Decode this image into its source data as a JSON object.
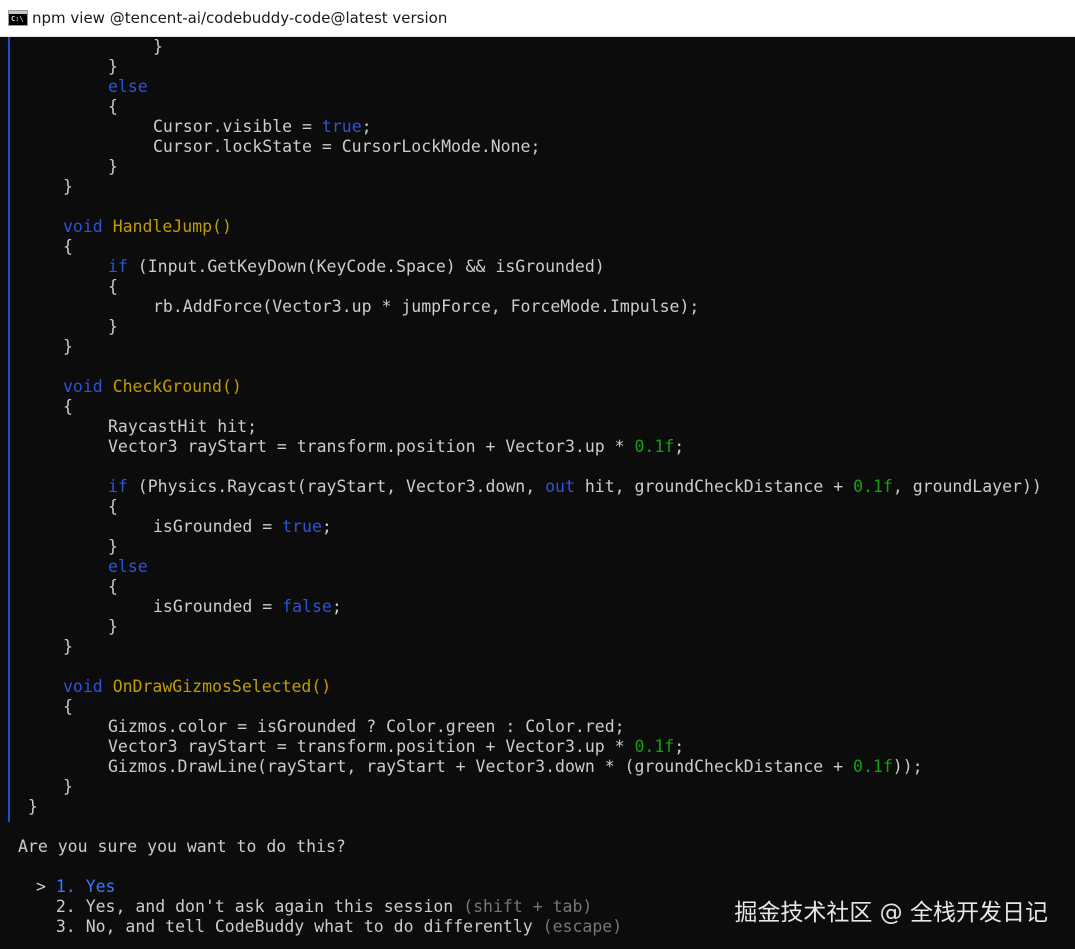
{
  "window": {
    "title": "npm view @tencent-ai/codebuddy-code@latest version",
    "icon_label": "C:\\"
  },
  "colors": {
    "default": "#cccccc",
    "keyword": "#2e54d6",
    "function": "#c19c00",
    "number": "#13a10e",
    "dim": "#767676",
    "selected": "#3b78ff",
    "background": "#0c0c0c"
  },
  "lines": [
    {
      "indent": 3,
      "segs": [
        {
          "t": "}",
          "c": "def"
        }
      ]
    },
    {
      "indent": 2,
      "segs": [
        {
          "t": "}",
          "c": "def"
        }
      ]
    },
    {
      "indent": 2,
      "segs": [
        {
          "t": "else",
          "c": "kw"
        }
      ]
    },
    {
      "indent": 2,
      "segs": [
        {
          "t": "{",
          "c": "def"
        }
      ]
    },
    {
      "indent": 3,
      "segs": [
        {
          "t": "Cursor.visible = ",
          "c": "def"
        },
        {
          "t": "true",
          "c": "kw"
        },
        {
          "t": ";",
          "c": "def"
        }
      ]
    },
    {
      "indent": 3,
      "segs": [
        {
          "t": "Cursor.lockState = CursorLockMode.None;",
          "c": "def"
        }
      ]
    },
    {
      "indent": 2,
      "segs": [
        {
          "t": "}",
          "c": "def"
        }
      ]
    },
    {
      "indent": 1,
      "segs": [
        {
          "t": "}",
          "c": "def"
        }
      ]
    },
    {
      "indent": 0,
      "segs": []
    },
    {
      "indent": 1,
      "segs": [
        {
          "t": "void",
          "c": "kw"
        },
        {
          "t": " ",
          "c": "def"
        },
        {
          "t": "HandleJump()",
          "c": "fn"
        }
      ]
    },
    {
      "indent": 1,
      "segs": [
        {
          "t": "{",
          "c": "def"
        }
      ]
    },
    {
      "indent": 2,
      "segs": [
        {
          "t": "if",
          "c": "kw"
        },
        {
          "t": " (Input.GetKeyDown(KeyCode.Space) && isGrounded)",
          "c": "def"
        }
      ]
    },
    {
      "indent": 2,
      "segs": [
        {
          "t": "{",
          "c": "def"
        }
      ]
    },
    {
      "indent": 3,
      "segs": [
        {
          "t": "rb.AddForce(Vector3.up * jumpForce, ForceMode.Impulse);",
          "c": "def"
        }
      ]
    },
    {
      "indent": 2,
      "segs": [
        {
          "t": "}",
          "c": "def"
        }
      ]
    },
    {
      "indent": 1,
      "segs": [
        {
          "t": "}",
          "c": "def"
        }
      ]
    },
    {
      "indent": 0,
      "segs": []
    },
    {
      "indent": 1,
      "segs": [
        {
          "t": "void",
          "c": "kw"
        },
        {
          "t": " ",
          "c": "def"
        },
        {
          "t": "CheckGround()",
          "c": "fn"
        }
      ]
    },
    {
      "indent": 1,
      "segs": [
        {
          "t": "{",
          "c": "def"
        }
      ]
    },
    {
      "indent": 2,
      "segs": [
        {
          "t": "RaycastHit hit;",
          "c": "def"
        }
      ]
    },
    {
      "indent": 2,
      "segs": [
        {
          "t": "Vector3 rayStart = transform.position + Vector3.up * ",
          "c": "def"
        },
        {
          "t": "0.1f",
          "c": "num"
        },
        {
          "t": ";",
          "c": "def"
        }
      ]
    },
    {
      "indent": 0,
      "segs": []
    },
    {
      "indent": 2,
      "segs": [
        {
          "t": "if",
          "c": "kw"
        },
        {
          "t": " (Physics.Raycast(rayStart, Vector3.down, ",
          "c": "def"
        },
        {
          "t": "out",
          "c": "kw"
        },
        {
          "t": " hit, groundCheckDistance + ",
          "c": "def"
        },
        {
          "t": "0.1f",
          "c": "num"
        },
        {
          "t": ", groundLayer))",
          "c": "def"
        }
      ]
    },
    {
      "indent": 2,
      "segs": [
        {
          "t": "{",
          "c": "def"
        }
      ]
    },
    {
      "indent": 3,
      "segs": [
        {
          "t": "isGrounded = ",
          "c": "def"
        },
        {
          "t": "true",
          "c": "kw"
        },
        {
          "t": ";",
          "c": "def"
        }
      ]
    },
    {
      "indent": 2,
      "segs": [
        {
          "t": "}",
          "c": "def"
        }
      ]
    },
    {
      "indent": 2,
      "segs": [
        {
          "t": "else",
          "c": "kw"
        }
      ]
    },
    {
      "indent": 2,
      "segs": [
        {
          "t": "{",
          "c": "def"
        }
      ]
    },
    {
      "indent": 3,
      "segs": [
        {
          "t": "isGrounded = ",
          "c": "def"
        },
        {
          "t": "false",
          "c": "kw"
        },
        {
          "t": ";",
          "c": "def"
        }
      ]
    },
    {
      "indent": 2,
      "segs": [
        {
          "t": "}",
          "c": "def"
        }
      ]
    },
    {
      "indent": 1,
      "segs": [
        {
          "t": "}",
          "c": "def"
        }
      ]
    },
    {
      "indent": 0,
      "segs": []
    },
    {
      "indent": 1,
      "segs": [
        {
          "t": "void",
          "c": "kw"
        },
        {
          "t": " ",
          "c": "def"
        },
        {
          "t": "OnDrawGizmosSelected()",
          "c": "fn"
        }
      ]
    },
    {
      "indent": 1,
      "segs": [
        {
          "t": "{",
          "c": "def"
        }
      ]
    },
    {
      "indent": 2,
      "segs": [
        {
          "t": "Gizmos.color = isGrounded ? Color.green : Color.red;",
          "c": "def"
        }
      ]
    },
    {
      "indent": 2,
      "segs": [
        {
          "t": "Vector3 rayStart = transform.position + Vector3.up * ",
          "c": "def"
        },
        {
          "t": "0.1f",
          "c": "num"
        },
        {
          "t": ";",
          "c": "def"
        }
      ]
    },
    {
      "indent": 2,
      "segs": [
        {
          "t": "Gizmos.DrawLine(rayStart, rayStart + Vector3.down * (groundCheckDistance + ",
          "c": "def"
        },
        {
          "t": "0.1f",
          "c": "num"
        },
        {
          "t": "));",
          "c": "def"
        }
      ]
    },
    {
      "indent": 1,
      "segs": [
        {
          "t": "}",
          "c": "def"
        }
      ]
    },
    {
      "indent": 0,
      "segs": [
        {
          "t": " }",
          "c": "def"
        }
      ]
    }
  ],
  "prompt": {
    "question": "Are you sure you want to do this?",
    "cursor": ">",
    "options": [
      {
        "number": "1.",
        "label": "Yes",
        "hint": ""
      },
      {
        "number": "2.",
        "label": "Yes, and don't ask again this session",
        "hint": "(shift + tab)"
      },
      {
        "number": "3.",
        "label": "No, and tell CodeBuddy what to do differently",
        "hint": "(escape)"
      }
    ],
    "selected_index": 0
  },
  "watermark": "掘金技术社区 @ 全栈开发日记"
}
